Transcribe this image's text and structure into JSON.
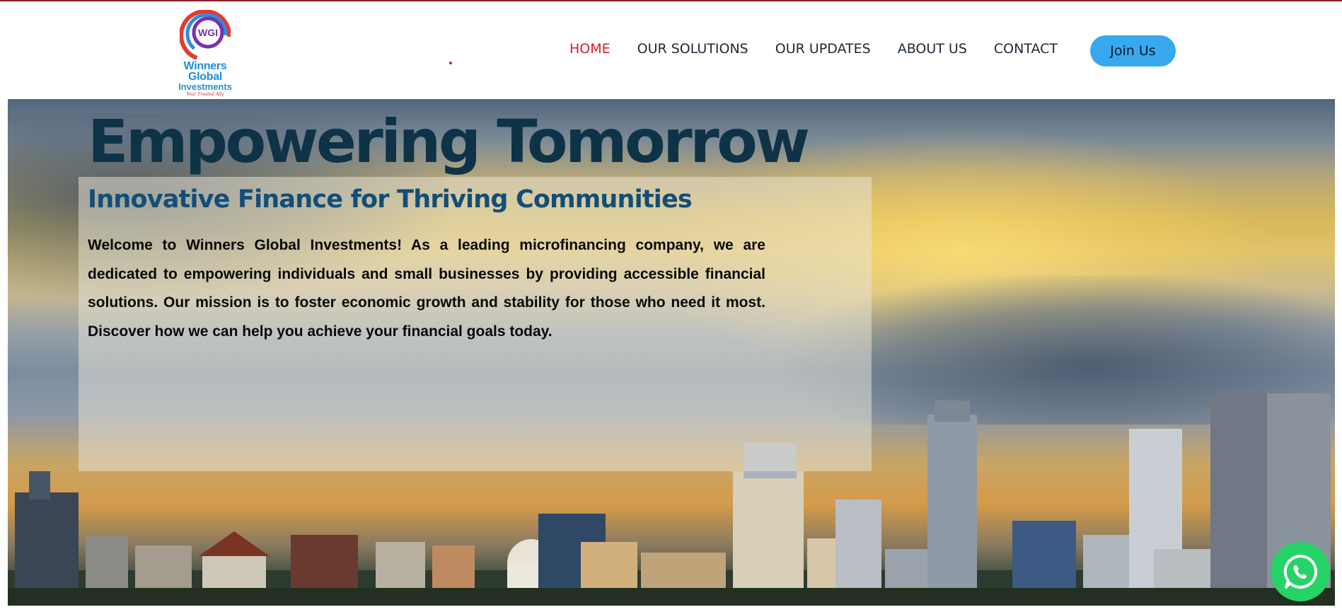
{
  "brand": {
    "logo_initials": "WGI",
    "name": "Winners Global",
    "name_line2": "Investments",
    "tagline": "Your Trusted Ally"
  },
  "nav": {
    "items": [
      {
        "label": "HOME",
        "active": true
      },
      {
        "label": "OUR SOLUTIONS",
        "active": false
      },
      {
        "label": "OUR UPDATES",
        "active": false
      },
      {
        "label": "ABOUT US",
        "active": false
      },
      {
        "label": "CONTACT",
        "active": false
      }
    ],
    "join_label": "Join Us"
  },
  "hero": {
    "title": "Empowering Tomorrow",
    "subtitle": "Innovative Finance for Thriving Communities",
    "body": "Welcome to Winners Global Investments! As a leading microfinancing company, we are dedicated to empowering individuals and small businesses by providing accessible financial solutions. Our mission is to foster economic growth and stability for those who need it most. Discover how we can help you achieve your financial goals today."
  },
  "colors": {
    "accent": "#d21f2f",
    "button": "#38a8ee",
    "title": "#0e3347",
    "subtitle": "#124e78",
    "whatsapp": "#25d366"
  },
  "icons": {
    "whatsapp": "whatsapp-icon",
    "logo": "wgi-logo-icon"
  }
}
